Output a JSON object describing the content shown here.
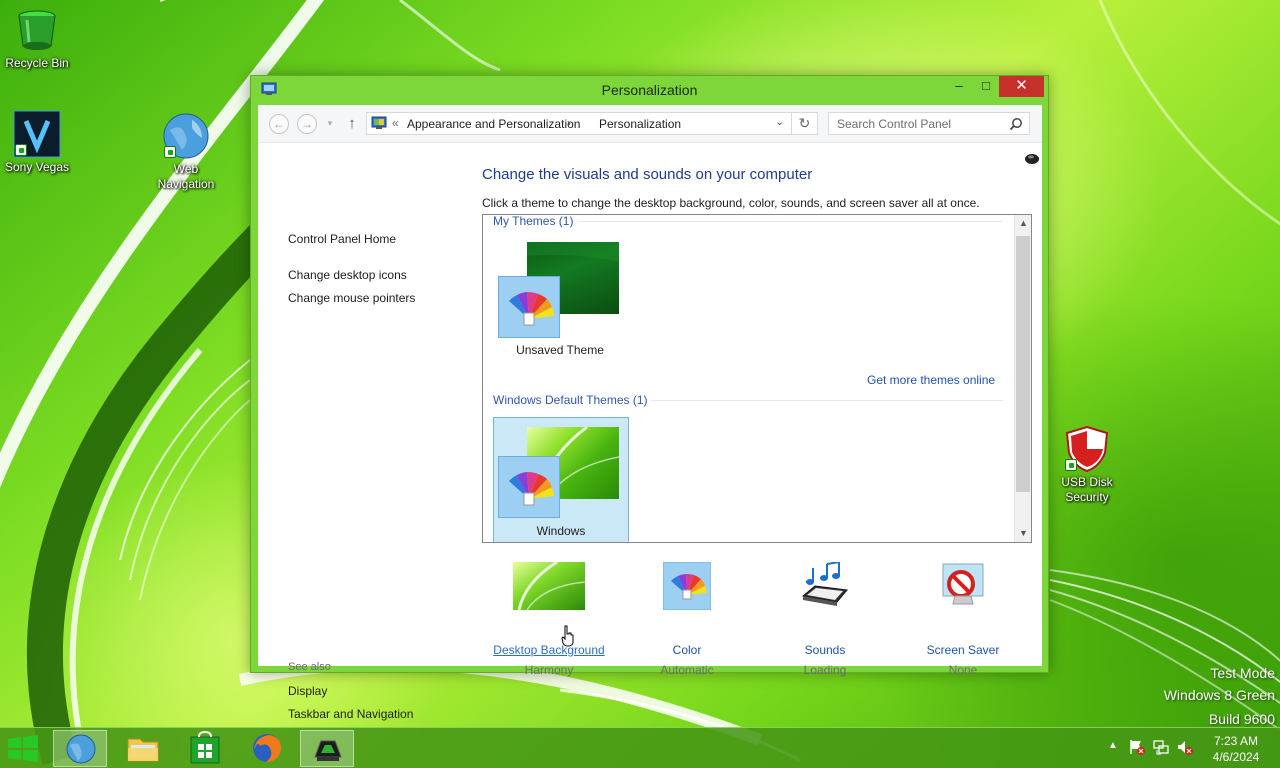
{
  "desktop": {
    "icons": [
      {
        "label": "Recycle Bin"
      },
      {
        "label": "Sony Vegas"
      },
      {
        "label": "Web Navigation"
      },
      {
        "label": "USB Disk Security"
      }
    ],
    "watermark": {
      "line1": "Test Mode",
      "line2": "Windows 8 Green",
      "line3": "Build 9600"
    }
  },
  "window": {
    "title": "Personalization",
    "controls": {
      "minimize": "–",
      "maximize": "□",
      "close": "✕"
    },
    "address": {
      "crumb_sep": "«",
      "crumbs": [
        "Appearance and Personalization",
        "Personalization"
      ],
      "arrow": "›"
    },
    "search": {
      "placeholder": "Search Control Panel"
    },
    "left_nav": {
      "home": "Control Panel Home",
      "links": [
        "Change desktop icons",
        "Change mouse pointers"
      ],
      "see_also_title": "See also",
      "see_also": [
        "Display",
        "Taskbar and Navigation"
      ]
    },
    "main": {
      "heading": "Change the visuals and sounds on your computer",
      "description": "Click a theme to change the desktop background, color, sounds, and screen saver all at once."
    },
    "themes": {
      "my_themes_header": "My Themes (1)",
      "my_themes": [
        {
          "name": "Unsaved Theme"
        }
      ],
      "more_link": "Get more themes online",
      "default_header": "Windows Default Themes (1)",
      "default_themes": [
        {
          "name": "Windows",
          "selected": true
        }
      ]
    },
    "settings": [
      {
        "label": "Desktop Background",
        "value": "Harmony"
      },
      {
        "label": "Color",
        "value": "Automatic"
      },
      {
        "label": "Sounds",
        "value": "Loading"
      },
      {
        "label": "Screen Saver",
        "value": "None"
      }
    ]
  },
  "taskbar": {
    "apps": [
      "start",
      "internet-explorer",
      "file-explorer",
      "store",
      "firefox",
      "personalization"
    ],
    "clock": {
      "time": "7:23 AM",
      "date": "4/6/2024"
    }
  },
  "colors": {
    "window_frame": "#7dd63a",
    "link": "#1f55a8",
    "heading": "#1f3d8a",
    "close_button": "#c7312b"
  }
}
